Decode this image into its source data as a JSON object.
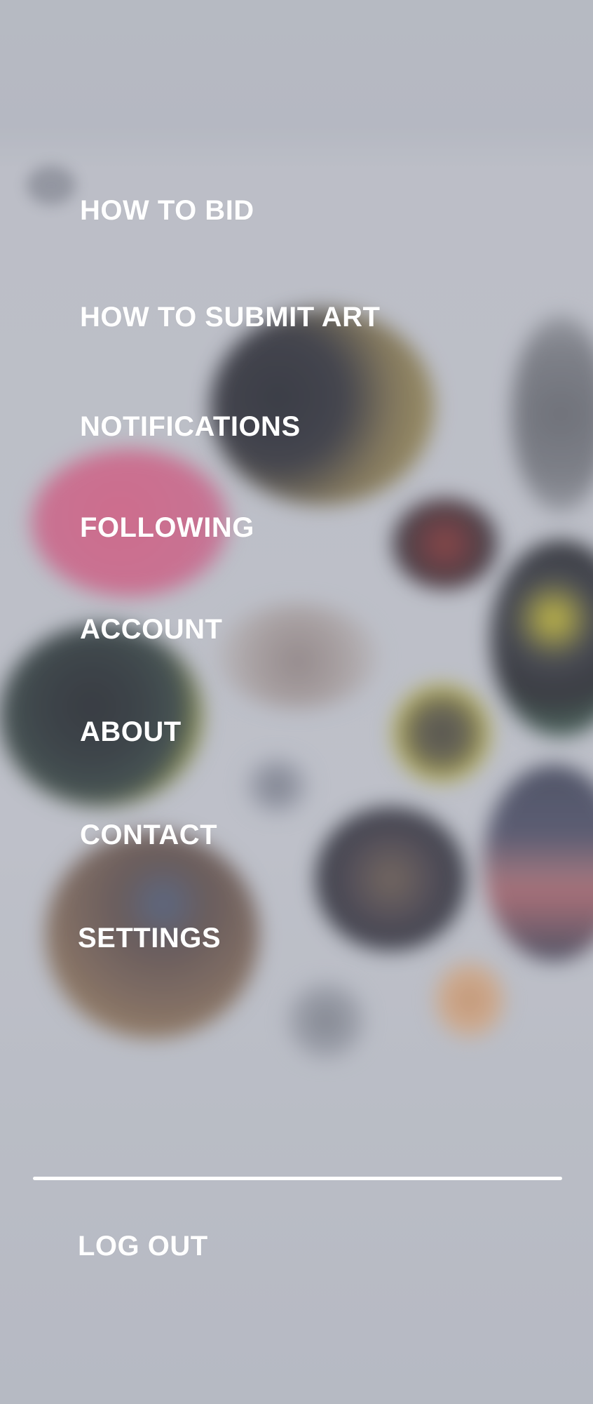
{
  "menu": {
    "items": [
      {
        "label": "HOW TO BID"
      },
      {
        "label": "HOW TO SUBMIT ART"
      },
      {
        "label": "NOTIFICATIONS"
      },
      {
        "label": "FOLLOWING"
      },
      {
        "label": "ACCOUNT"
      },
      {
        "label": "ABOUT"
      },
      {
        "label": "CONTACT"
      },
      {
        "label": "SETTINGS"
      }
    ],
    "logout_label": "LOG OUT"
  },
  "colors": {
    "overlay": "#b9bcc5",
    "menu_text": "#ffffff",
    "divider": "#ffffff"
  }
}
